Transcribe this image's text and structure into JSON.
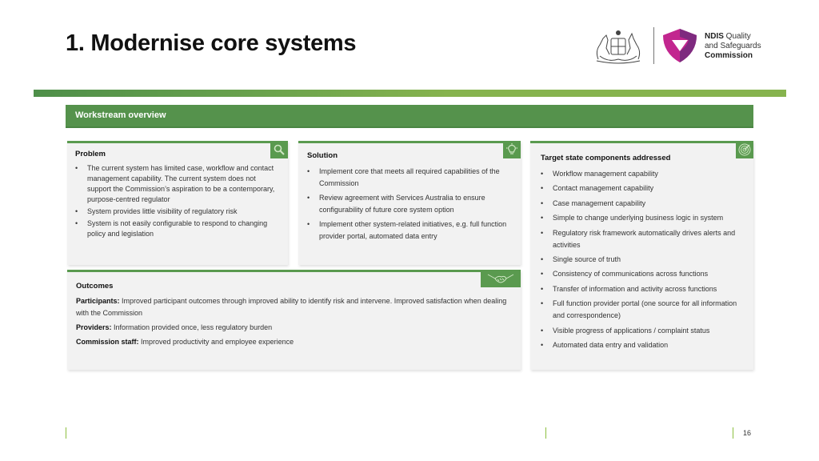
{
  "page": {
    "title": "1. Modernise core systems",
    "page_number": "16"
  },
  "logo": {
    "crest_name": "australian-coat-of-arms",
    "org_line1_bold": "NDIS",
    "org_line1_rest": " Quality",
    "org_line2": "and Safeguards",
    "org_line3": "Commission"
  },
  "workstream": {
    "header": "Workstream overview"
  },
  "problem": {
    "heading": "Problem",
    "icon": "magnifier-icon",
    "items": [
      "The current system has limited case, workflow and contact management capability. The current system does not support the Commission’s aspiration to be a contemporary, purpose-centred regulator",
      "System provides little visibility of regulatory risk",
      "System is not easily configurable to respond to changing policy and legislation"
    ]
  },
  "solution": {
    "heading": "Solution",
    "icon": "lightbulb-icon",
    "items": [
      "Implement core that meets all required capabilities of the Commission",
      "Review agreement with Services Australia to ensure configurability of future core system option",
      "Implement other system-related initiatives, e.g. full function provider portal, automated data entry"
    ]
  },
  "target": {
    "heading": "Target state components addressed",
    "icon": "target-icon",
    "items": [
      "Workflow management capability",
      "Contact management capability",
      "Case management capability",
      "Simple to change underlying business logic in system",
      "Regulatory risk framework automatically drives alerts and activities",
      "Single source of truth",
      "Consistency of communications across functions",
      "Transfer of information and activity across functions",
      "Full function provider portal (one source for all information and correspondence)",
      "Visible progress of applications / complaint status",
      "Automated data entry and validation"
    ]
  },
  "outcomes": {
    "heading": "Outcomes",
    "icon": "handshake-icon",
    "lines": [
      {
        "label": "Participants:",
        "text": " Improved participant outcomes through improved ability to identify risk and intervene. Improved satisfaction when dealing with the Commission"
      },
      {
        "label": "Providers:",
        "text": " Information provided once, less regulatory burden"
      },
      {
        "label": "Commission staff:",
        "text": " Improved productivity and employee experience"
      }
    ]
  },
  "colors": {
    "accent_green": "#55924c",
    "bar_green_light": "#86b34e",
    "footer_line": "#8cbf3f",
    "logo_magenta": "#c2268f"
  }
}
